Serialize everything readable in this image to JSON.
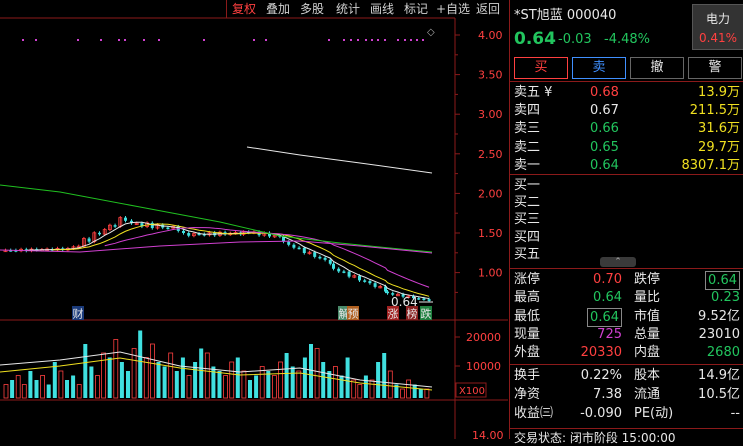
{
  "toolbar": {
    "items": [
      "复权",
      "叠加",
      "多股",
      "统计",
      "画线",
      "标记",
      "+自选",
      "返回"
    ],
    "active_index": 0
  },
  "chart": {
    "price_ticks": [
      "4.00",
      "3.50",
      "3.00",
      "2.50",
      "2.00",
      "1.50",
      "1.00"
    ],
    "vol_ticks": [
      "20000",
      "10000"
    ],
    "vol_unit": "X100",
    "bottom_tick": "14.00",
    "last_price_label": "0.64",
    "markers": [
      {
        "label": "财",
        "color": "#e8e8e8",
        "bg": "#1a3a7a"
      },
      {
        "label": "解",
        "color": "#e8e8e8",
        "bg": "#4a8a6a"
      },
      {
        "label": "预",
        "color": "#e8e8e8",
        "bg": "#b06020"
      },
      {
        "label": "涨",
        "color": "#e8e8e8",
        "bg": "#a02020"
      },
      {
        "label": "榜",
        "color": "#e8e8e8",
        "bg": "#8a2020"
      },
      {
        "label": "跌",
        "color": "#e8e8e8",
        "bg": "#208040"
      }
    ],
    "colors": {
      "up": "#ff4040",
      "down": "#40e0e0",
      "ma5": "#e8e8e8",
      "ma10": "#f0e020",
      "ma20": "#d040d0",
      "ma60": "#20c020"
    }
  },
  "quote": {
    "title": "*ST旭蓝 000040",
    "price": "0.64",
    "change": "-0.03",
    "change_pct": "-4.48%",
    "sector_name": "电力",
    "sector_pct": "0.41%",
    "buttons": [
      "买",
      "卖",
      "撤",
      "警"
    ],
    "asks": [
      {
        "label": "卖五 ¥",
        "price": "0.68",
        "vol": "13.9万"
      },
      {
        "label": "卖四",
        "price": "0.67",
        "vol": "211.5万"
      },
      {
        "label": "卖三",
        "price": "0.66",
        "vol": "31.6万"
      },
      {
        "label": "卖二",
        "price": "0.65",
        "vol": "29.7万"
      },
      {
        "label": "卖一",
        "price": "0.64",
        "vol": "8307.1万"
      }
    ],
    "bids": [
      {
        "label": "买一"
      },
      {
        "label": "买二"
      },
      {
        "label": "买三"
      },
      {
        "label": "买四"
      },
      {
        "label": "买五"
      }
    ],
    "stats": {
      "zt_label": "涨停",
      "zt": "0.70",
      "dt_label": "跌停",
      "dt": "0.64",
      "high_label": "最高",
      "high": "0.64",
      "lb_label": "量比",
      "lb": "0.23",
      "low_label": "最低",
      "low": "0.64",
      "mv_label": "市值",
      "mv": "9.52亿",
      "cur_label": "现量",
      "cur": "725",
      "tv_label": "总量",
      "tv": "23010",
      "out_label": "外盘",
      "out": "20330",
      "in_label": "内盘",
      "in": "2680",
      "turn_label": "换手",
      "turn": "0.22%",
      "cap_label": "股本",
      "cap": "14.9亿",
      "na_label": "净资",
      "na": "7.38",
      "flow_label": "流通",
      "flow": "10.5亿",
      "eps_label": "收益㈢",
      "eps": "-0.090",
      "pe_label": "PE(动)",
      "pe": "--"
    },
    "status": "交易状态: 闭市阶段 15:00:00"
  }
}
